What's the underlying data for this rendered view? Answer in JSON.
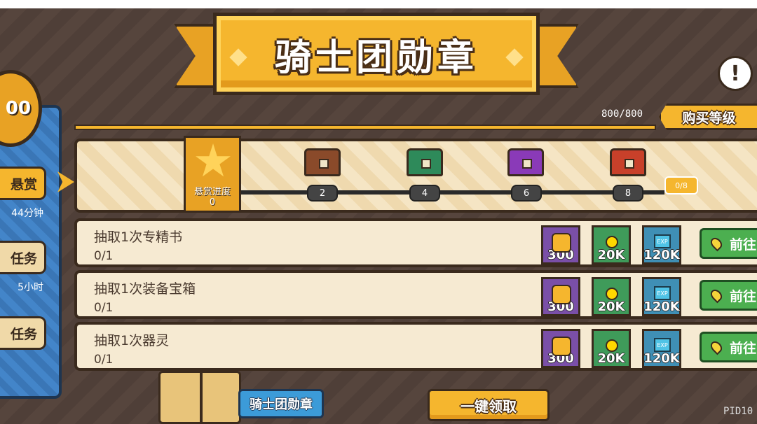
{
  "banner": {
    "title": "骑士团勋章"
  },
  "header": {
    "xp_count": "800/800",
    "buy_level_label": "购买等级",
    "info_icon": "exclamation-icon"
  },
  "sidebar": {
    "medal_value": "00",
    "items": [
      {
        "label": "悬赏",
        "sub": "44分钟",
        "active": true
      },
      {
        "label": "任务",
        "sub": "5小时",
        "active": false
      },
      {
        "label": "任务",
        "sub": "",
        "active": false
      }
    ]
  },
  "track": {
    "badge_label": "悬赏进度",
    "badge_value": "0",
    "nodes": [
      {
        "value": "2",
        "chest": "wood-chest-icon",
        "color": "#8a4a2a"
      },
      {
        "value": "4",
        "chest": "green-chest-icon",
        "color": "#2e8a5a"
      },
      {
        "value": "6",
        "chest": "purple-chest-icon",
        "color": "#8a3ab8"
      },
      {
        "value": "8",
        "chest": "red-chest-icon",
        "color": "#c8402a"
      }
    ],
    "loop_label": "0/8"
  },
  "tasks": [
    {
      "name": "抽取1次专精书",
      "progress": "0/1",
      "rewards": [
        "300",
        "20K",
        "120K"
      ],
      "go_label": "前往"
    },
    {
      "name": "抽取1次装备宝箱",
      "progress": "0/1",
      "rewards": [
        "300",
        "20K",
        "120K"
      ],
      "go_label": "前往"
    },
    {
      "name": "抽取1次器灵",
      "progress": "0/1",
      "rewards": [
        "300",
        "20K",
        "120K"
      ],
      "go_label": "前往"
    }
  ],
  "bottom": {
    "medal_button": "骑士团勋章",
    "claim_all": "一键领取",
    "pid": "PID10"
  },
  "colors": {
    "accent": "#f5b62e",
    "go_button": "#4caf50",
    "sidebar": "#3c7bbf"
  }
}
